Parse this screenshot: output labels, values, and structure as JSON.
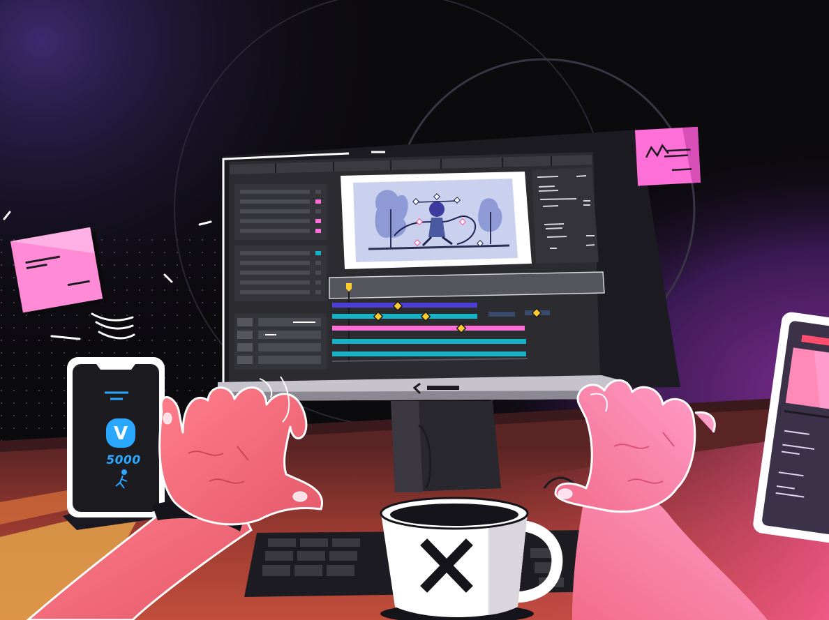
{
  "scene": {
    "kind": "illustration",
    "phone": {
      "logo": "V",
      "steps": "5000",
      "icon": "runner-icon"
    },
    "mug": {
      "icon": "x-mark-icon"
    },
    "monitor": {
      "app": "video-editor-timeline"
    },
    "colors": {
      "background": "#0b0a0d",
      "glow_purple": "#3a1f6a",
      "skin": "#f06b79",
      "skin_light": "#ff8fa0",
      "desk": "#c2503b",
      "accent_pink": "#ff6fd8",
      "accent_teal": "#16b3c7",
      "accent_blue": "#4d3fd6",
      "keyframe_yellow": "#ffcc2e",
      "phone_blue": "#2aa8ff"
    }
  }
}
